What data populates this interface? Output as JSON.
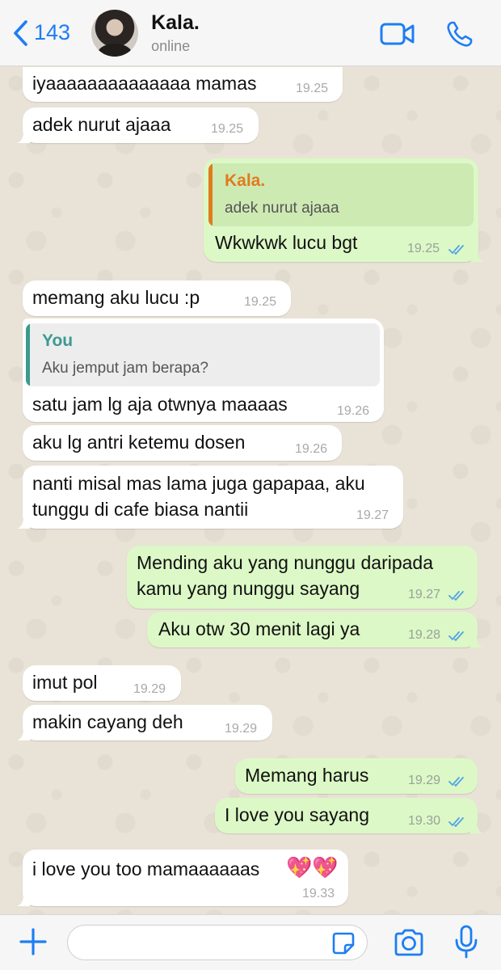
{
  "colors": {
    "accent": "#1d7ef3",
    "bubble_in": "#ffffff",
    "bubble_out": "#dcf8c6",
    "tick_read": "#4fa3e6",
    "quote_kala": "#e07b1f",
    "quote_you": "#3b9a90"
  },
  "header": {
    "back_count": "143",
    "contact_name": "Kala.",
    "status": "online",
    "icons": [
      "chevron-left-icon",
      "video-call-icon",
      "phone-icon"
    ]
  },
  "messages": [
    {
      "dir": "in",
      "text": "iyaaaaaaaaaaaaaa mamas",
      "time": "19.25"
    },
    {
      "dir": "in",
      "text": "adek nurut ajaaa",
      "time": "19.25"
    },
    {
      "dir": "out",
      "quote_name": "Kala.",
      "quote_text": "adek nurut ajaaa",
      "text": "Wkwkwk lucu bgt",
      "time": "19.25",
      "read": true
    },
    {
      "dir": "in",
      "text": "memang aku lucu :p",
      "time": "19.25"
    },
    {
      "dir": "in",
      "quote_name": "You",
      "quote_text": "Aku jemput jam berapa?",
      "text": "satu jam lg aja otwnya maaaas",
      "time": "19.26"
    },
    {
      "dir": "in",
      "text": "aku lg antri ketemu dosen",
      "time": "19.26"
    },
    {
      "dir": "in",
      "text_line1": "nanti misal mas lama juga gapapaa, aku",
      "text_line2": "tunggu di cafe biasa nantii",
      "time": "19.27"
    },
    {
      "dir": "out",
      "text_line1": "Mending aku yang nunggu daripada",
      "text_line2": "kamu yang nunggu sayang",
      "time": "19.27",
      "read": true
    },
    {
      "dir": "out",
      "text": "Aku otw 30 menit lagi ya",
      "time": "19.28",
      "read": true
    },
    {
      "dir": "in",
      "text": "imut pol",
      "time": "19.29"
    },
    {
      "dir": "in",
      "text": "makin cayang deh",
      "time": "19.29"
    },
    {
      "dir": "out",
      "text": "Memang harus",
      "time": "19.29",
      "read": true
    },
    {
      "dir": "out",
      "text": "I love you sayang",
      "time": "19.30",
      "read": true
    },
    {
      "dir": "in",
      "text": "i love you too mamaaaaaas",
      "emoji": "💖💖",
      "time": "19.33"
    }
  ],
  "composer": {
    "placeholder": "",
    "icons": [
      "plus-icon",
      "sticker-icon",
      "camera-icon",
      "microphone-icon"
    ]
  }
}
